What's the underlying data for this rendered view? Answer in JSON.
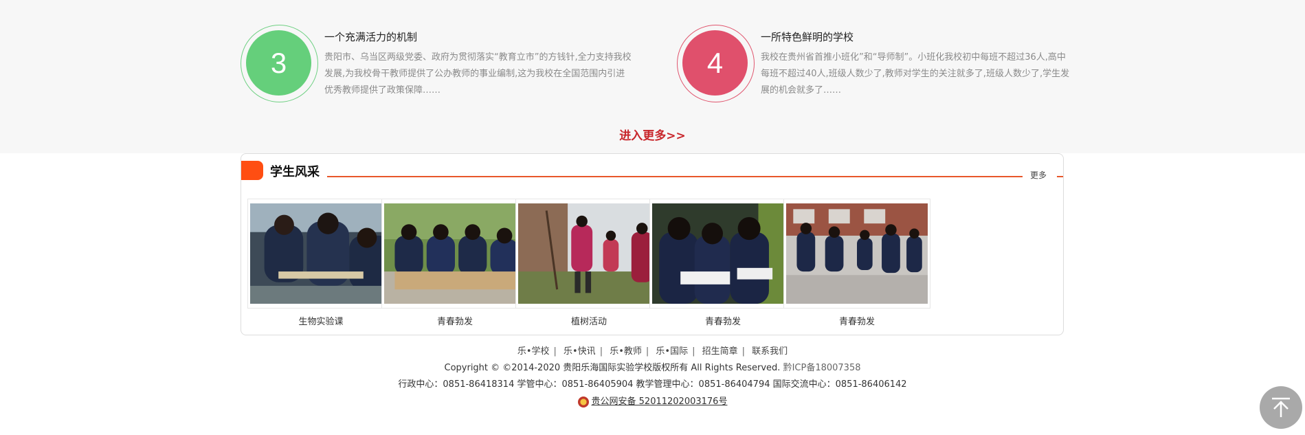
{
  "features": [
    {
      "number": "3",
      "title": "一个充满活力的机制",
      "text": "贵阳市、乌当区两级党委、政府为贯彻落实“教育立市”的方钱针,全力支持我校发展,为我校骨干教师提供了公办教师的事业编制,这为我校在全国范围内引进优秀教师提供了政策保障……",
      "color": "#65cf7b"
    },
    {
      "number": "4",
      "title": "一所特色鲜明的学校",
      "text": "我校在贵州省首推小班化”和“导师制”。小班化我校初中每班不超过36人,高中每班不超过40人,班级人数少了,教师对学生的关注就多了,班级人数少了,学生发展的机会就多了……",
      "color": "#e0506c"
    }
  ],
  "more_link": "进入更多>>",
  "section": {
    "title": "学生风采",
    "more": "更多",
    "accent": "#ff4e12"
  },
  "gallery": [
    {
      "caption": "生物实验课",
      "icon": "photo-students-lab"
    },
    {
      "caption": "青春勃发",
      "icon": "photo-students-reading"
    },
    {
      "caption": "植树活动",
      "icon": "photo-tree-planting"
    },
    {
      "caption": "青春勃发",
      "icon": "photo-girls-reading"
    },
    {
      "caption": "青春勃发",
      "icon": "photo-students-walking"
    }
  ],
  "footer": {
    "nav": [
      "乐•学校",
      "乐•快讯",
      "乐•教师",
      "乐•国际",
      "招生简章",
      "联系我们"
    ],
    "copyright": "Copyright © ©2014-2020    贵阳乐海国际实验学校版权所有 All Rights Reserved.",
    "icp": "黔ICP备18007358",
    "phones": "行政中心：0851-86418314  学管中心：0851-86405904  教学管理中心：0851-86404794  国际交流中心：0851-86406142",
    "police": "贵公网安备 52011202003176号"
  },
  "back_to_top_icon": "arrow-up-icon"
}
